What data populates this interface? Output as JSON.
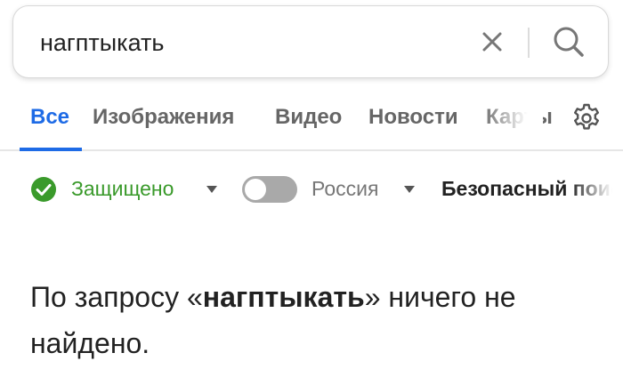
{
  "search": {
    "query": "нагптыкать",
    "clear_icon": "close-icon",
    "search_icon": "search-icon"
  },
  "tabs": [
    {
      "label": "Все",
      "active": true
    },
    {
      "label": "Изображения",
      "active": false
    },
    {
      "label": "Видео",
      "active": false
    },
    {
      "label": "Новости",
      "active": false
    },
    {
      "label": "Карты",
      "active": false
    }
  ],
  "settings_icon": "gear-icon",
  "filters": {
    "safe": {
      "label": "Защищено",
      "icon": "check-circle-icon",
      "color": "#3a9a2b"
    },
    "region": {
      "label": "Россия",
      "toggle_on": false
    },
    "safesearch": {
      "label": "Безопасный поиск"
    }
  },
  "message": {
    "prefix": "По запросу «",
    "query": "нагптыкать",
    "suffix": "» ничего не найдено."
  },
  "colors": {
    "accent": "#1e6be6",
    "safe_green": "#3a9a2b"
  }
}
